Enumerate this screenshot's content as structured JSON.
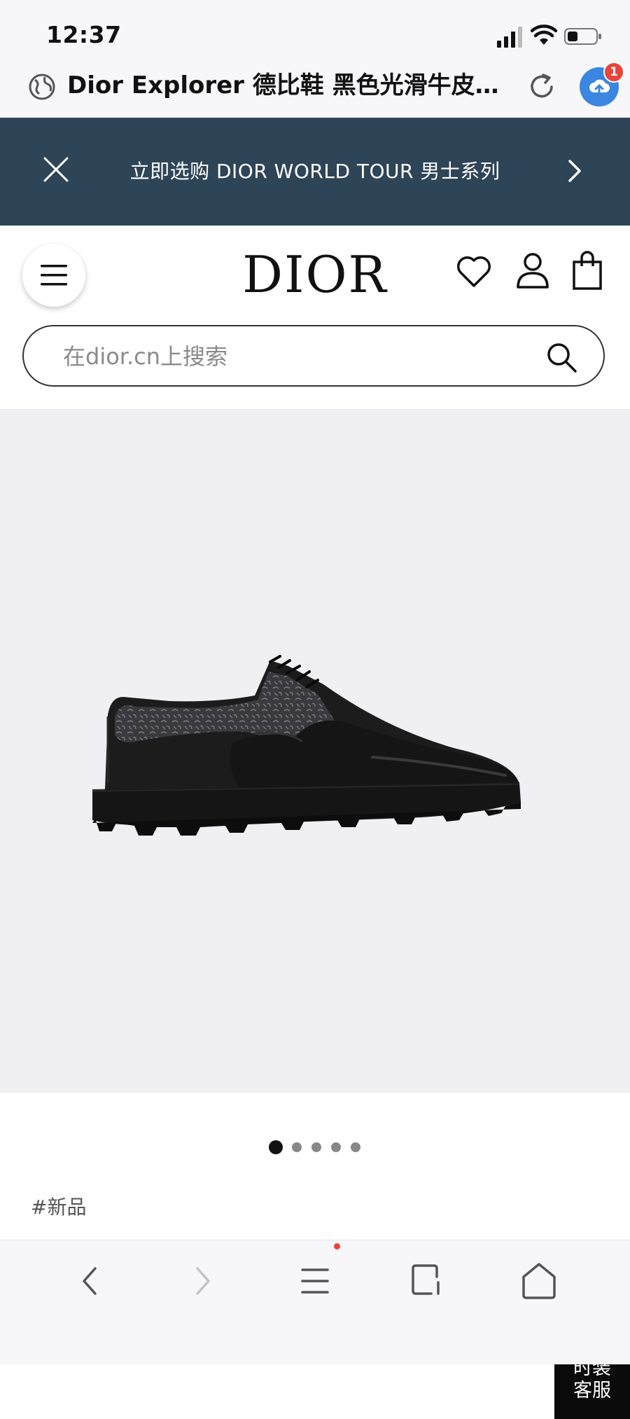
{
  "status_bar": {
    "time": "12:37"
  },
  "browser": {
    "page_title": "Dior Explorer 德比鞋 黑色光滑牛皮革…",
    "upload_badge_count": "1",
    "toolbar": {
      "back_icon": "chevron-left-icon",
      "forward_icon": "chevron-right-icon",
      "menu_icon": "menu-icon",
      "tabs_icon": "tabs-icon",
      "home_icon": "home-icon"
    }
  },
  "promo": {
    "text": "立即选购 DIOR WORLD TOUR 男士系列"
  },
  "header": {
    "logo": "DIOR"
  },
  "search": {
    "placeholder": "在dior.cn上搜索"
  },
  "product": {
    "carousel": {
      "total": 5,
      "active_index": 0
    },
    "tag": "#新品"
  },
  "chat_widget": {
    "line1": "时装",
    "line2": "客服"
  },
  "colors": {
    "promo_bg": "#2e4457",
    "upload_blue": "#3a86e0",
    "badge_red": "#e8443a",
    "product_bg": "#f0f0f2"
  }
}
